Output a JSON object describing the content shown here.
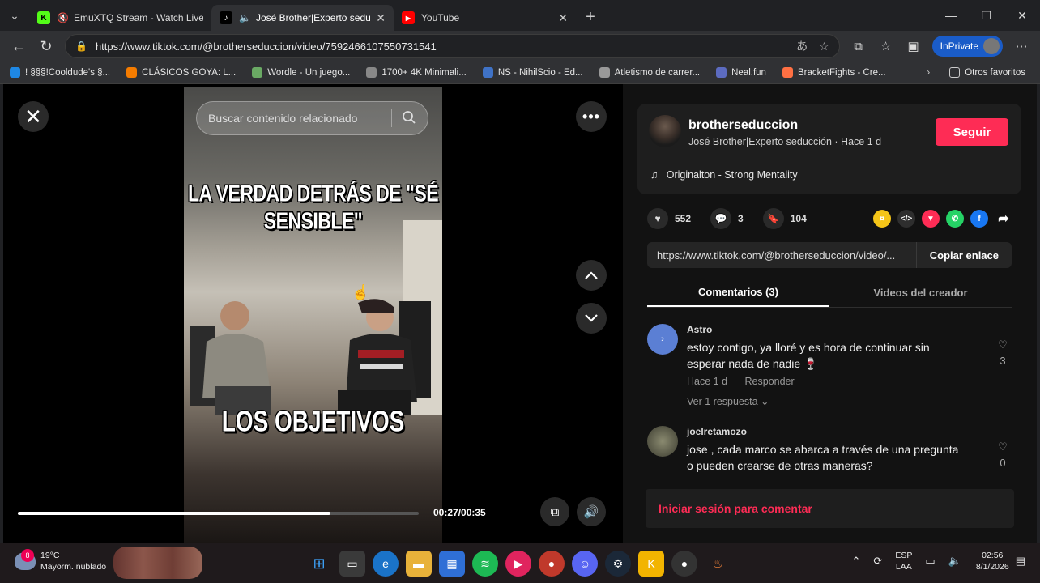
{
  "browser": {
    "tabs": [
      {
        "title": "EmuXTQ Stream - Watch Live",
        "favicon": "kick-icon",
        "color": "#53fc18",
        "glyph": "K"
      },
      {
        "title": "José Brother|Experto seducción",
        "favicon": "tiktok-icon",
        "color": "#000000",
        "glyph": "♪"
      },
      {
        "title": "YouTube",
        "favicon": "youtube-icon",
        "color": "#ff0000",
        "glyph": "▶"
      }
    ],
    "url": "https://www.tiktok.com/@brotherseduccion/video/7592466107550731541",
    "inprivate_label": "InPrivate",
    "bookmarks": [
      {
        "label": "! §§§!Cooldude's §...",
        "color": "#1e88e5"
      },
      {
        "label": "CLÁSICOS GOYA: L...",
        "color": "#f57c00"
      },
      {
        "label": "Wordle - Un juego...",
        "color": "#6aaa64"
      },
      {
        "label": "1700+ 4K Minimali...",
        "color": "#888888"
      },
      {
        "label": "NS - NihilScio - Ed...",
        "color": "#3f72c6"
      },
      {
        "label": "Atletismo de carrer...",
        "color": "#999999"
      },
      {
        "label": "Neal.fun",
        "color": "#5c6bc0"
      },
      {
        "label": "BracketFights - Cre...",
        "color": "#ff7043"
      }
    ],
    "bookmarks_more": "›",
    "other_favorites": "Otros favoritos"
  },
  "player": {
    "search_placeholder": "Buscar contenido relacionado",
    "caption_top": "LA VERDAD DETRÁS DE \"SÉ SENSIBLE\"",
    "caption_bottom": "LOS OBJETIVOS",
    "time": "00:27/00:35",
    "progress": 0.78
  },
  "creator": {
    "username": "brotherseduccion",
    "subtitle": "José Brother|Experto seducción · Hace 1 d",
    "follow_label": "Seguir",
    "music": "Originalton - Strong Mentality"
  },
  "stats": {
    "likes": "552",
    "comments": "3",
    "saves": "104"
  },
  "share_link": {
    "url": "https://www.tiktok.com/@brotherseduccion/video/...",
    "copy_label": "Copiar enlace"
  },
  "tabs": {
    "comments": "Comentarios (3)",
    "creator_videos": "Videos del creador"
  },
  "comments": [
    {
      "user": "Astro",
      "text": "estoy contigo, ya lloré y es hora de continuar sin esperar nada de nadie 🍷",
      "time": "Hace 1 d",
      "reply": "Responder",
      "replies": "Ver 1 respuesta ⌄",
      "likes": "3",
      "avatar_color": "#5b7fd4"
    },
    {
      "user": "joelretamozo_",
      "text": "jose , cada marco se abarca a través de una pregunta o pueden crearse de otras maneras?",
      "likes": "0",
      "avatar_color": "#6b6b5a"
    }
  ],
  "login_prompt": "Iniciar sesión para comentar",
  "taskbar": {
    "weather_temp": "19°C",
    "weather_desc": "Mayorm. nublado",
    "weather_badge": "8",
    "lang_top": "ESP",
    "lang_bottom": "LAA",
    "time": "02:56",
    "date": "8/1/2026"
  }
}
